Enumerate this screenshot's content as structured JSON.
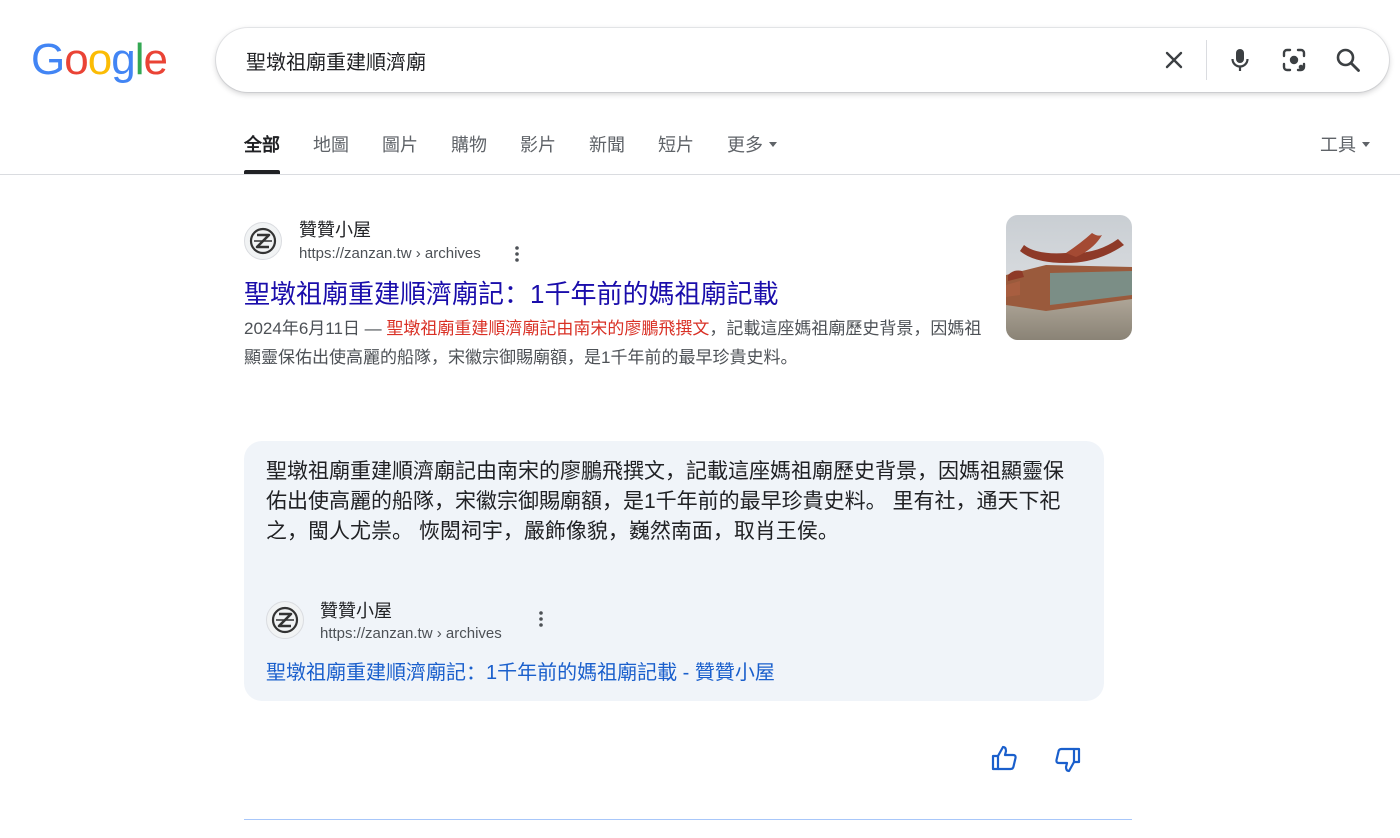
{
  "search": {
    "query": "聖墩祖廟重建順濟廟"
  },
  "tabs": [
    {
      "label": "全部",
      "active": true
    },
    {
      "label": "地圖"
    },
    {
      "label": "圖片"
    },
    {
      "label": "購物"
    },
    {
      "label": "影片"
    },
    {
      "label": "新聞"
    },
    {
      "label": "短片"
    },
    {
      "label": "更多"
    }
  ],
  "tools_label": "工具",
  "result": {
    "site_name": "贊贊小屋",
    "url": "https://zanzan.tw › archives",
    "title": "聖墩祖廟重建順濟廟記：1千年前的媽祖廟記載",
    "date": "2024年6月11日 — ",
    "snippet_highlight": "聖墩祖廟重建順濟廟記由南宋的廖鵬飛撰文",
    "snippet_rest": "，記載這座媽祖廟歷史背景，因媽祖顯靈保佑出使高麗的船隊，宋徽宗御賜廟額，是1千年前的最早珍貴史料。"
  },
  "featured": {
    "text": "聖墩祖廟重建順濟廟記由南宋的廖鵬飛撰文，記載這座媽祖廟歷史背景，因媽祖顯靈保佑出使高麗的船隊，宋徽宗御賜廟額，是1千年前的最早珍貴史料。 里有社，通天下祀之，閩人尤祟。 恢閎祠宇，嚴飾像貌，巍然南面，取肖王侯。",
    "source_name": "贊贊小屋",
    "source_url": "https://zanzan.tw › archives",
    "link": "聖墩祖廟重建順濟廟記：1千年前的媽祖廟記載 - 贊贊小屋"
  },
  "colors": {
    "link_title": "#1a0dab",
    "featured_link": "#1a5fcc",
    "highlight": "#d93025",
    "featured_bg": "#f0f4f9",
    "google_blue": "#4285f4",
    "google_red": "#ea4335",
    "google_yellow": "#fbbc05",
    "google_green": "#34a853"
  },
  "icons": [
    "clear-icon",
    "microphone-icon",
    "lens-icon",
    "search-icon",
    "more-vert-icon",
    "thumbs-up-icon",
    "thumbs-down-icon"
  ]
}
